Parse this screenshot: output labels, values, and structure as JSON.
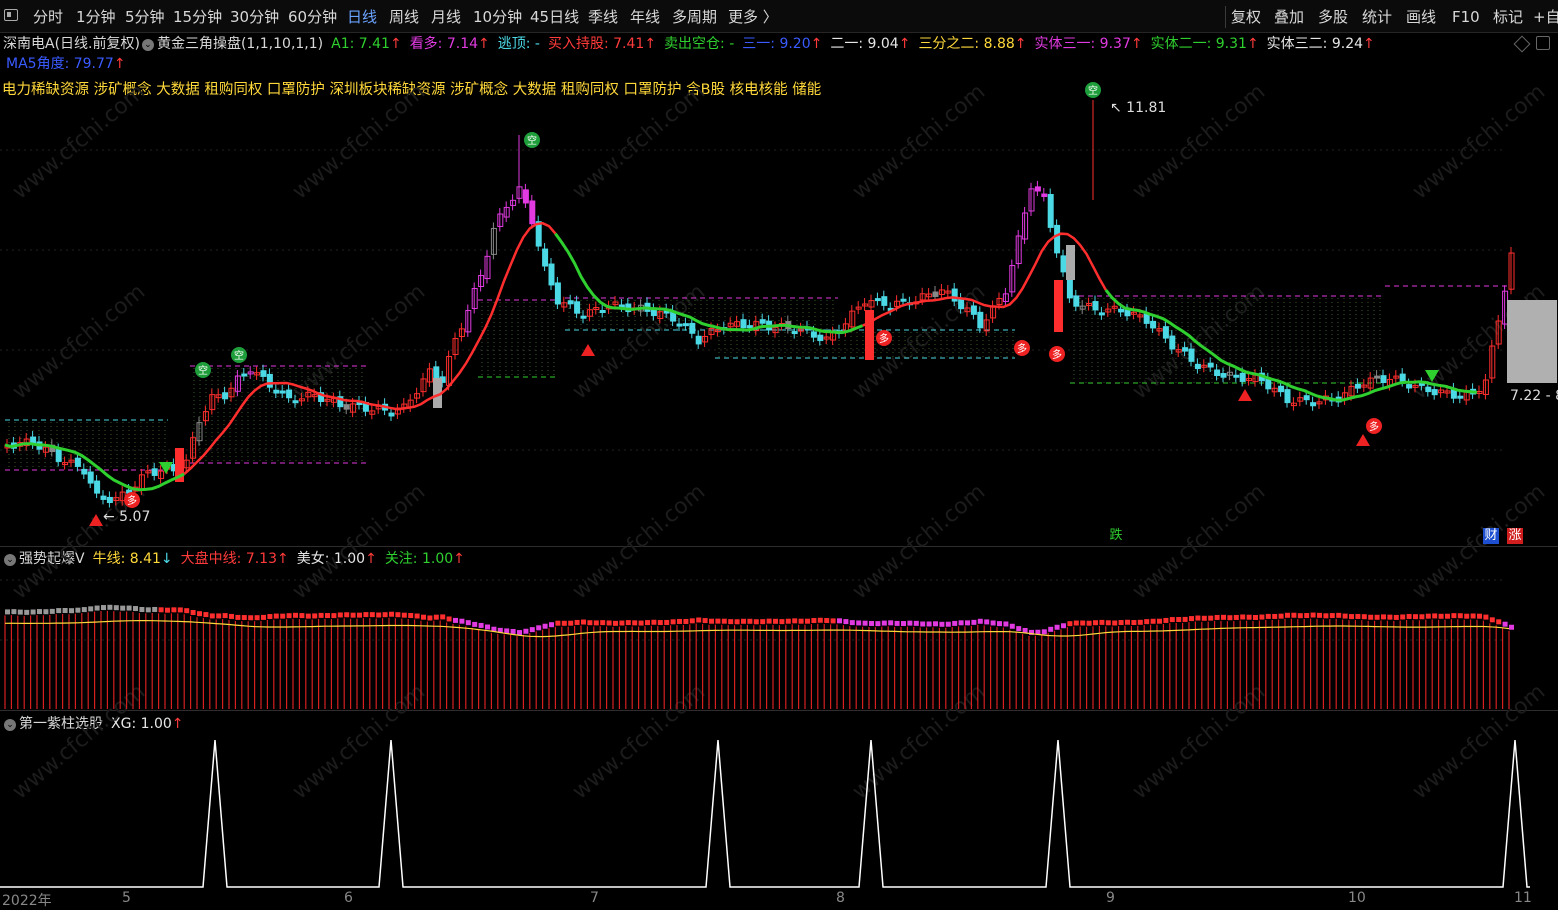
{
  "toolbar": {
    "periods": [
      "分时",
      "1分钟",
      "5分钟",
      "15分钟",
      "30分钟",
      "60分钟",
      "日线",
      "周线",
      "月线",
      "10分钟",
      "45日线",
      "季线",
      "年线",
      "多周期",
      "更多 〉"
    ],
    "active_index": 6,
    "right_items": [
      "复权",
      "叠加",
      "多股",
      "统计",
      "画线",
      "F10",
      "标记",
      "+自"
    ]
  },
  "main_panel": {
    "stock": "深南电A(日线.前复权)",
    "indicator": "黄金三角操盘(1,1,10,1,1)",
    "values": [
      {
        "label": "A1: 7.41",
        "color": "#2fcf2f",
        "arrow": "↑"
      },
      {
        "label": "看多: 7.14",
        "color": "#e03ae0",
        "arrow": "↑"
      },
      {
        "label": "逃顶: -",
        "color": "#4cd9e6",
        "arrow": ""
      },
      {
        "label": "买入持股: 7.41",
        "color": "#ff3b3b",
        "arrow": "↑"
      },
      {
        "label": "卖出空仓: -",
        "color": "#2fcf2f",
        "arrow": ""
      },
      {
        "label": "三一: 9.20",
        "color": "#3a5bff",
        "arrow": "↑"
      },
      {
        "label": "二一: 9.04",
        "color": "#e6e6e6",
        "arrow": "↑"
      },
      {
        "label": "三分之二: 8.88",
        "color": "#ffd83a",
        "arrow": "↑"
      },
      {
        "label": "实体三一: 9.37",
        "color": "#e03ae0",
        "arrow": "↑"
      },
      {
        "label": "实体二一: 9.31",
        "color": "#2fcf2f",
        "arrow": "↑"
      },
      {
        "label": "实体三二: 9.24",
        "color": "#e6e6e6",
        "arrow": "↑"
      }
    ],
    "ma5_label": "MA5角度: 79.77",
    "ma5_arrow": "↑",
    "concepts": "电力稀缺资源 涉矿概念 大数据 租购同权 口罩防护 深圳板块稀缺资源 涉矿概念 大数据 租购同权 口罩防护 含B股 核电核能 储能",
    "high_label": "11.81",
    "low_label": "5.07",
    "current_label": "7.22 - 8",
    "signal_empty": "空",
    "signal_long": "多",
    "event_drop": "跌",
    "event_fin": "财",
    "event_rise": "涨"
  },
  "panel2": {
    "name": "强势起爆V",
    "values": [
      {
        "label": "牛线: 8.41",
        "color": "#ffd83a",
        "arrow": "↓",
        "arrow_color": "#4cd9e6"
      },
      {
        "label": "大盘中线: 7.13",
        "color": "#ff3b3b",
        "arrow": "↑",
        "arrow_color": "#ff3b3b"
      },
      {
        "label": "美女: 1.00",
        "color": "#e6e6e6",
        "arrow": "↑",
        "arrow_color": "#ff3b3b"
      },
      {
        "label": "关注: 1.00",
        "color": "#2fcf2f",
        "arrow": "↑",
        "arrow_color": "#ff3b3b"
      }
    ]
  },
  "panel3": {
    "name": "第一紫柱选股",
    "values": [
      {
        "label": "XG: 1.00",
        "color": "#e6e6e6",
        "arrow": "↑",
        "arrow_color": "#ff3b3b"
      }
    ]
  },
  "x_axis": [
    "2022年",
    "5",
    "6",
    "7",
    "8",
    "9",
    "10",
    "11"
  ],
  "watermark": "www.cfchi.com",
  "colors": {
    "up": "#ff2e2e",
    "down": "#4cd9e6",
    "pink": "#e03ae0",
    "green": "#2fcf2f",
    "yellow": "#ffd83a",
    "gray": "#888888"
  }
}
